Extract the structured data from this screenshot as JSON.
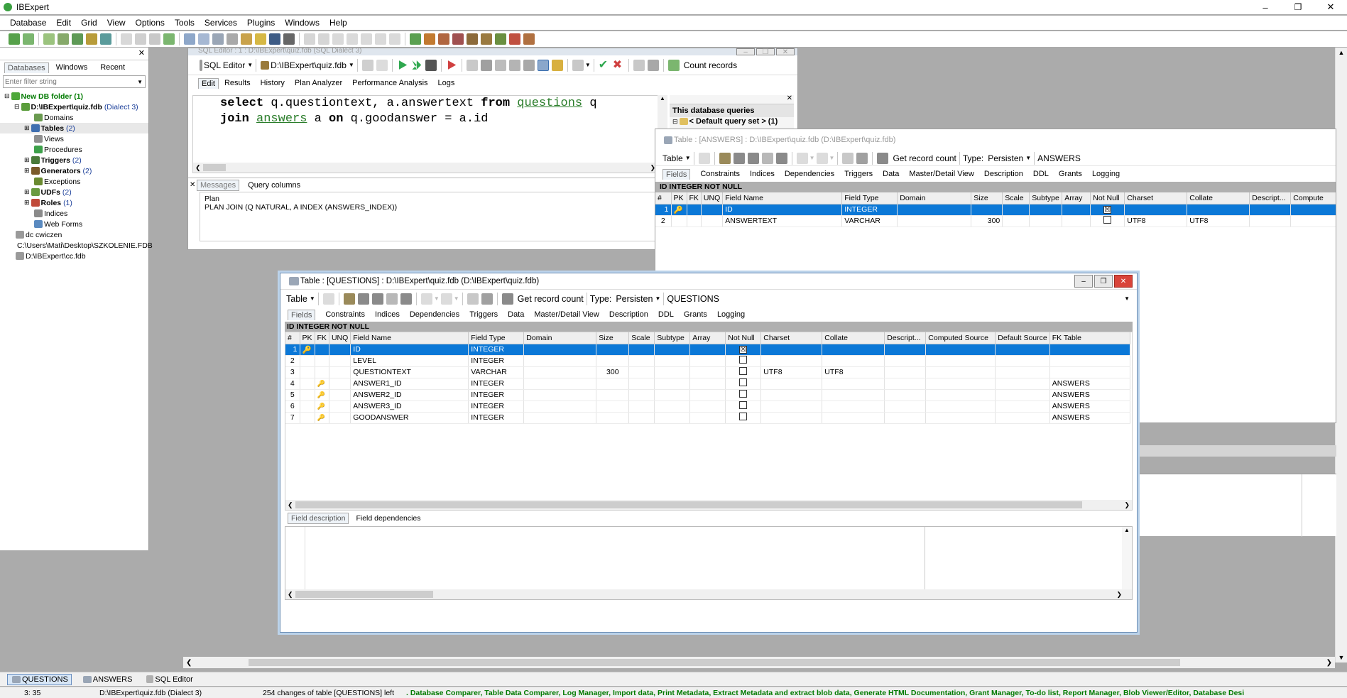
{
  "app": {
    "title": "IBExpert",
    "window_controls": [
      "–",
      "❐",
      "✕"
    ]
  },
  "menu": [
    "Database",
    "Edit",
    "Grid",
    "View",
    "Options",
    "Tools",
    "Services",
    "Plugins",
    "Windows",
    "Help"
  ],
  "left_panel": {
    "tabs": [
      "Databases",
      "Windows",
      "Recent"
    ],
    "filter_placeholder": "Enter filter string",
    "tree": {
      "folder": "New DB folder (1)",
      "db": "D:\\IBExpert\\quiz.fdb",
      "db_dialect": "(Dialect 3)",
      "nodes": [
        {
          "label": "Domains",
          "count": ""
        },
        {
          "label": "Tables",
          "count": "(2)"
        },
        {
          "label": "Views",
          "count": ""
        },
        {
          "label": "Procedures",
          "count": ""
        },
        {
          "label": "Triggers",
          "count": "(2)"
        },
        {
          "label": "Generators",
          "count": "(2)"
        },
        {
          "label": "Exceptions",
          "count": ""
        },
        {
          "label": "UDFs",
          "count": "(2)"
        },
        {
          "label": "Roles",
          "count": "(1)"
        },
        {
          "label": "Indices",
          "count": ""
        },
        {
          "label": "Web Forms",
          "count": ""
        }
      ],
      "other_dbs": [
        "dc cwiczen",
        "C:\\Users\\Mati\\Desktop\\SZKOLENIE.FDB",
        "D:\\IBExpert\\cc.fdb"
      ]
    }
  },
  "sql_editor": {
    "title": "SQL Editor : 1 : D:\\IBExpert\\quiz.fdb (SQL Dialect 3)",
    "label": "SQL Editor",
    "db_select": "D:\\IBExpert\\quiz.fdb",
    "count_records": "Count records",
    "tabs": [
      "Edit",
      "Results",
      "History",
      "Plan Analyzer",
      "Performance Analysis",
      "Logs"
    ],
    "line1": {
      "k1": "select",
      "t1": " q.questiontext, a.answertext ",
      "k2": "from",
      "t2": " ",
      "tbl": "questions",
      "t3": " q"
    },
    "line2": {
      "k1": "join",
      "t1": " ",
      "tbl": "answers",
      "t2": " a ",
      "k2": "on",
      "t3": " q.goodanswer = a.id"
    },
    "msg_tabs": [
      "Messages",
      "Query columns"
    ],
    "plan_label": "Plan",
    "plan_text": "PLAN JOIN (Q NATURAL, A INDEX (ANSWERS_INDEX))",
    "queries_header": "This database queries",
    "queries_item": "< Default query set > (1)"
  },
  "answers_window": {
    "title": "Table : [ANSWERS] : D:\\IBExpert\\quiz.fdb (D:\\IBExpert\\quiz.fdb)",
    "table_btn": "Table",
    "get_count": "Get record count",
    "type_label": "Type:",
    "type_value": "Persisten",
    "name": "ANSWERS",
    "tabs": [
      "Fields",
      "Constraints",
      "Indices",
      "Dependencies",
      "Triggers",
      "Data",
      "Master/Detail View",
      "Description",
      "DDL",
      "Grants",
      "Logging"
    ],
    "info": "ID INTEGER NOT NULL",
    "columns": [
      "#",
      "PK",
      "FK",
      "UNQ",
      "Field Name",
      "Field Type",
      "Domain",
      "Size",
      "Scale",
      "Subtype",
      "Array",
      "Not Null",
      "Charset",
      "Collate",
      "Descript...",
      "Compute"
    ],
    "rows": [
      {
        "n": "1",
        "name": "ID",
        "type": "INTEGER",
        "size": "",
        "nn": "☒",
        "cs": "",
        "col": ""
      },
      {
        "n": "2",
        "name": "ANSWERTEXT",
        "type": "VARCHAR",
        "size": "300",
        "nn": "",
        "cs": "UTF8",
        "col": "UTF8"
      }
    ]
  },
  "questions_window": {
    "title": "Table : [QUESTIONS] : D:\\IBExpert\\quiz.fdb (D:\\IBExpert\\quiz.fdb)",
    "table_btn": "Table",
    "get_count": "Get record count",
    "type_label": "Type:",
    "type_value": "Persisten",
    "name": "QUESTIONS",
    "tabs": [
      "Fields",
      "Constraints",
      "Indices",
      "Dependencies",
      "Triggers",
      "Data",
      "Master/Detail View",
      "Description",
      "DDL",
      "Grants",
      "Logging"
    ],
    "info": "ID INTEGER NOT NULL",
    "columns": [
      "#",
      "PK",
      "FK",
      "UNQ",
      "Field Name",
      "Field Type",
      "Domain",
      "Size",
      "Scale",
      "Subtype",
      "Array",
      "Not Null",
      "Charset",
      "Collate",
      "Descript...",
      "Computed Source",
      "Default Source",
      "FK Table"
    ],
    "rows": [
      {
        "n": "1",
        "fk": "",
        "name": "ID",
        "type": "INTEGER",
        "size": "",
        "nn": "☒",
        "cs": "",
        "col": "",
        "fkt": ""
      },
      {
        "n": "2",
        "fk": "",
        "name": "LEVEL",
        "type": "INTEGER",
        "size": "",
        "nn": "",
        "cs": "",
        "col": "",
        "fkt": ""
      },
      {
        "n": "3",
        "fk": "",
        "name": "QUESTIONTEXT",
        "type": "VARCHAR",
        "size": "300",
        "nn": "",
        "cs": "UTF8",
        "col": "UTF8",
        "fkt": ""
      },
      {
        "n": "4",
        "fk": "🔑",
        "name": "ANSWER1_ID",
        "type": "INTEGER",
        "size": "",
        "nn": "",
        "cs": "",
        "col": "",
        "fkt": "ANSWERS"
      },
      {
        "n": "5",
        "fk": "🔑",
        "name": "ANSWER2_ID",
        "type": "INTEGER",
        "size": "",
        "nn": "",
        "cs": "",
        "col": "",
        "fkt": "ANSWERS"
      },
      {
        "n": "6",
        "fk": "🔑",
        "name": "ANSWER3_ID",
        "type": "INTEGER",
        "size": "",
        "nn": "",
        "cs": "",
        "col": "",
        "fkt": "ANSWERS"
      },
      {
        "n": "7",
        "fk": "🔑",
        "name": "GOODANSWER",
        "type": "INTEGER",
        "size": "",
        "nn": "",
        "cs": "",
        "col": "",
        "fkt": "ANSWERS"
      }
    ],
    "bottom_tabs": [
      "Field description",
      "Field dependencies"
    ]
  },
  "taskbar": [
    "QUESTIONS",
    "ANSWERS",
    "SQL Editor"
  ],
  "status": {
    "pos": "3:  35",
    "db": "D:\\IBExpert\\quiz.fdb (Dialect 3)",
    "changes": "254 changes of table [QUESTIONS] left",
    "features": ". Database Comparer, Table Data Comparer, Log Manager, Import data, Print Metadata, Extract Metadata and extract blob data, Generate HTML Documentation, Grant Manager, To-do list, Report Manager, Blob Viewer/Editor, Database Desi"
  },
  "colors": {
    "selection": "#0b78d7",
    "feature_text": "#007a00",
    "keyword_table": "#2a7d2a"
  }
}
